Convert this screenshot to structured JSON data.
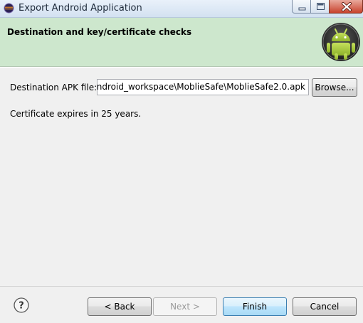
{
  "window": {
    "title": "Export Android Application"
  },
  "header": {
    "title": "Destination and key/certificate checks",
    "logo_icon": "android-logo-icon"
  },
  "form": {
    "destination_label": "Destination APK file:",
    "destination_value": "ndroid_workspace\\MoblieSafe\\MoblieSafe2.0.apk",
    "browse_label": "Browse...",
    "certificate_text": "Certificate expires in 25 years."
  },
  "footer": {
    "help_icon": "help-icon",
    "back_label": "< Back",
    "next_label": "Next >",
    "finish_label": "Finish",
    "cancel_label": "Cancel"
  },
  "colors": {
    "header_bg": "#cde7cd",
    "android_green": "#a4c639",
    "close_red": "#c8432d",
    "default_button_border": "#3c7fb1"
  }
}
